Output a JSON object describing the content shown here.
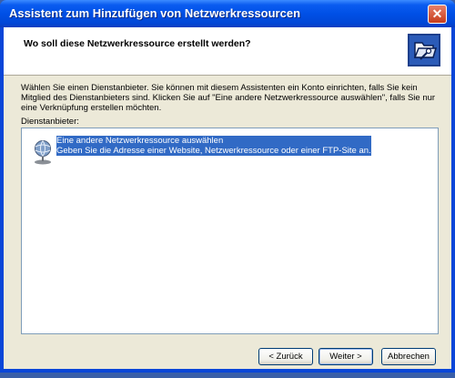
{
  "window": {
    "title": "Assistent zum Hinzufügen von Netzwerkressourcen",
    "close_glyph": "✕"
  },
  "header": {
    "title": "Wo soll diese Netzwerkressource erstellt werden?",
    "icon": "network-folder-icon"
  },
  "body": {
    "description": "Wählen Sie einen Dienstanbieter. Sie können mit diesem Assistenten ein Konto einrichten, falls Sie kein Mitglied des Dienstanbieters sind. Klicken Sie auf \"Eine andere Netzwerkressource auswählen\", falls Sie nur eine Verknüpfung erstellen möchten.",
    "list_label": "Dienstanbieter:",
    "providers": [
      {
        "title": "Eine andere Netzwerkressource auswählen",
        "subtitle": "Geben Sie die Adresse einer Website, Netzwerkressource oder einer FTP-Site an.",
        "icon": "network-globe-icon",
        "selected": true
      }
    ]
  },
  "buttons": {
    "back": "< Zurück",
    "next": "Weiter >",
    "cancel": "Abbrechen"
  },
  "colors": {
    "title_bar": "#0050e6",
    "selection": "#316ac5",
    "dialog_bg": "#ece9d8"
  }
}
